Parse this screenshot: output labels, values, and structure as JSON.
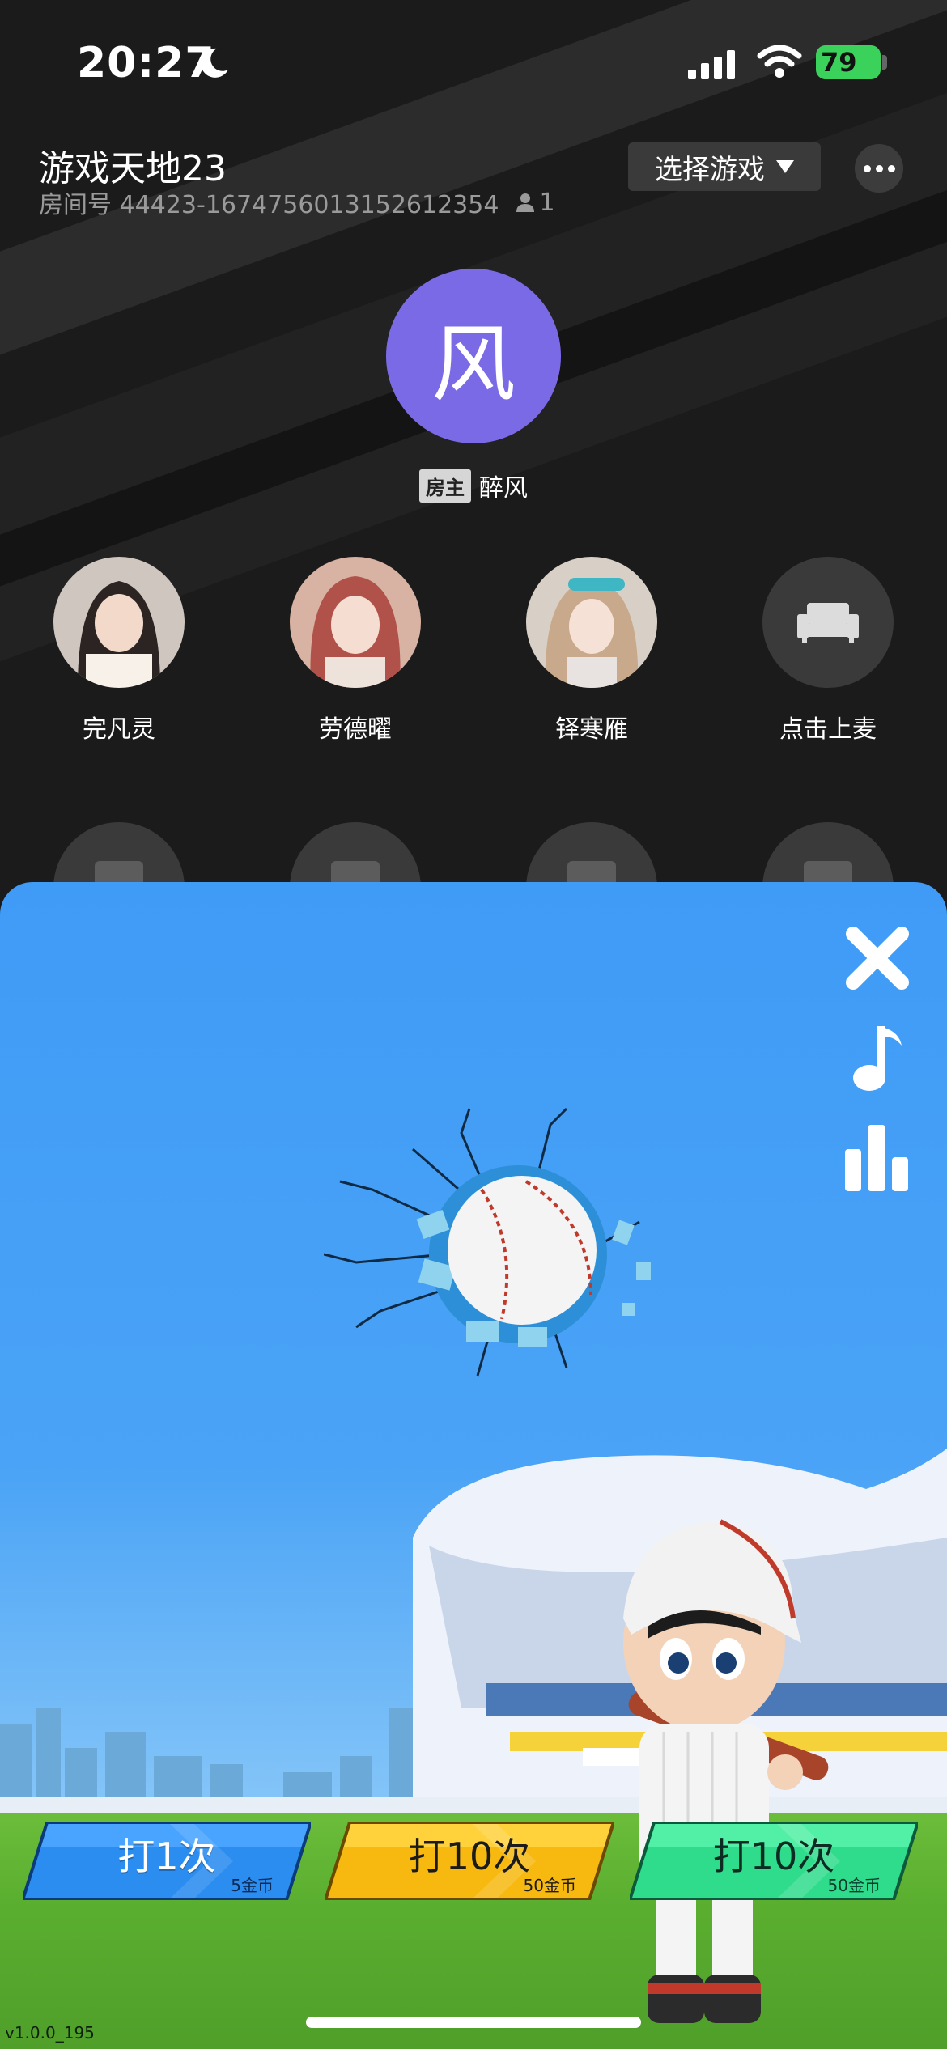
{
  "status_bar": {
    "time": "20:27",
    "battery": "79"
  },
  "room": {
    "title": "游戏天地23",
    "id_label": "房间号 44423-1674756013152612354",
    "member_count": "1",
    "select_game_label": "选择游戏"
  },
  "host": {
    "avatar_char": "风",
    "badge": "房主",
    "name": "醉风"
  },
  "seats": [
    {
      "name": "完凡灵"
    },
    {
      "name": "劳德曜"
    },
    {
      "name": "铎寒雁"
    },
    {
      "name": "点击上麦"
    }
  ],
  "game": {
    "buttons": [
      {
        "label": "打1次",
        "cost": "5金币",
        "color": "#2b8df0"
      },
      {
        "label": "打10次",
        "cost": "50金币",
        "color": "#f7b90f"
      },
      {
        "label": "打10次",
        "cost": "50金币",
        "color": "#2fdc8c"
      }
    ]
  },
  "version": "v1.0.0_195"
}
